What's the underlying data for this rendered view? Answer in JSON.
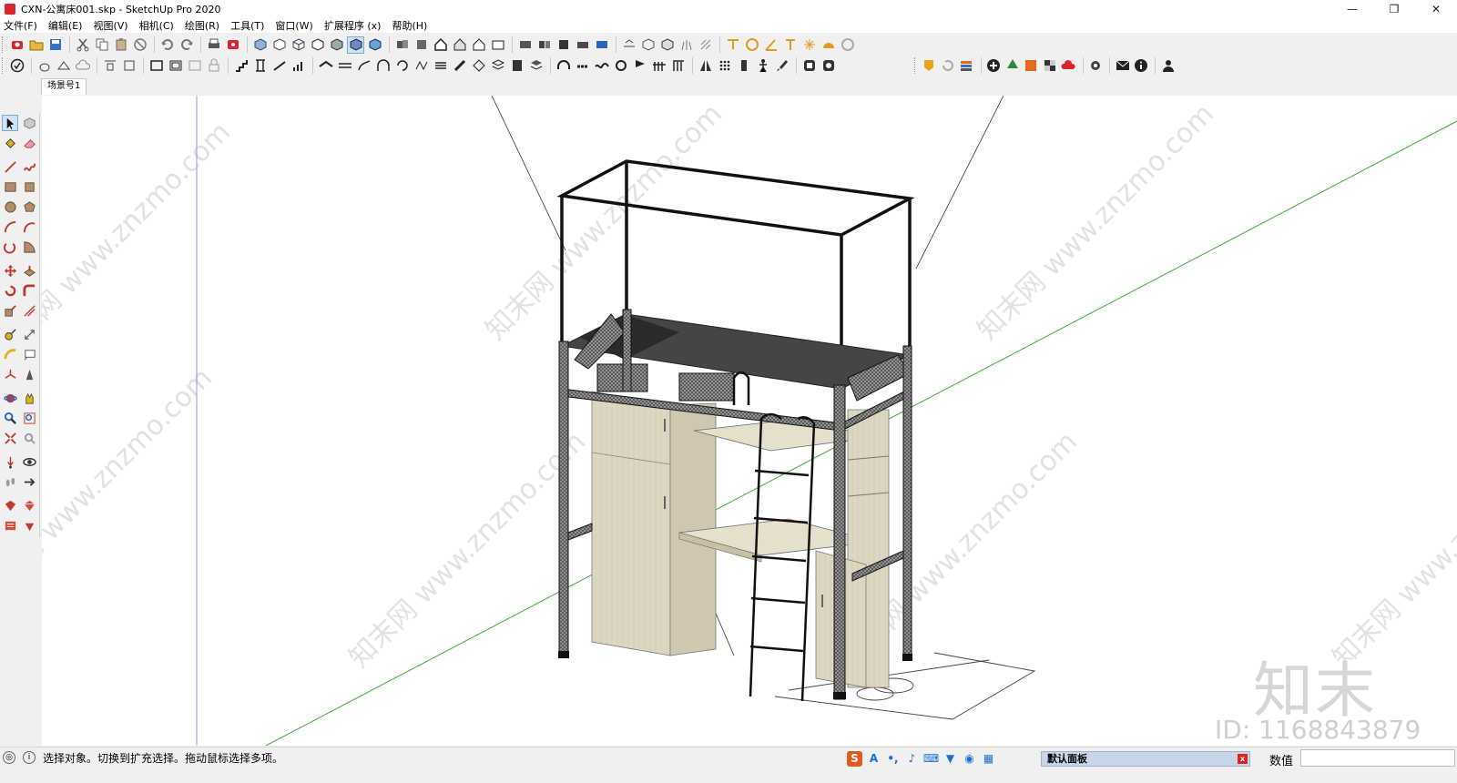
{
  "window": {
    "title": "CXN-公寓床001.skp - SketchUp Pro 2020",
    "controls": {
      "minimize": "—",
      "restore": "❐",
      "close": "✕"
    }
  },
  "menubar": {
    "items": [
      "文件(F)",
      "编辑(E)",
      "视图(V)",
      "相机(C)",
      "绘图(R)",
      "工具(T)",
      "窗口(W)",
      "扩展程序 (x)",
      "帮助(H)"
    ]
  },
  "scene": {
    "tab_label": "场景号1"
  },
  "watermark": {
    "repeat_text": "知末网 www.znzmo.com",
    "logo": "知末",
    "id": "ID: 1168843879"
  },
  "statusbar": {
    "message": "选择对象。切换到扩充选择。拖动鼠标选择多项。",
    "panel_title": "默认面板",
    "measure_label": "数值",
    "measure_value": ""
  },
  "colors": {
    "axis_green": "#3fa83f",
    "frame_black": "#111111",
    "wood": "#ddd6c3",
    "mattress": "#454545"
  }
}
